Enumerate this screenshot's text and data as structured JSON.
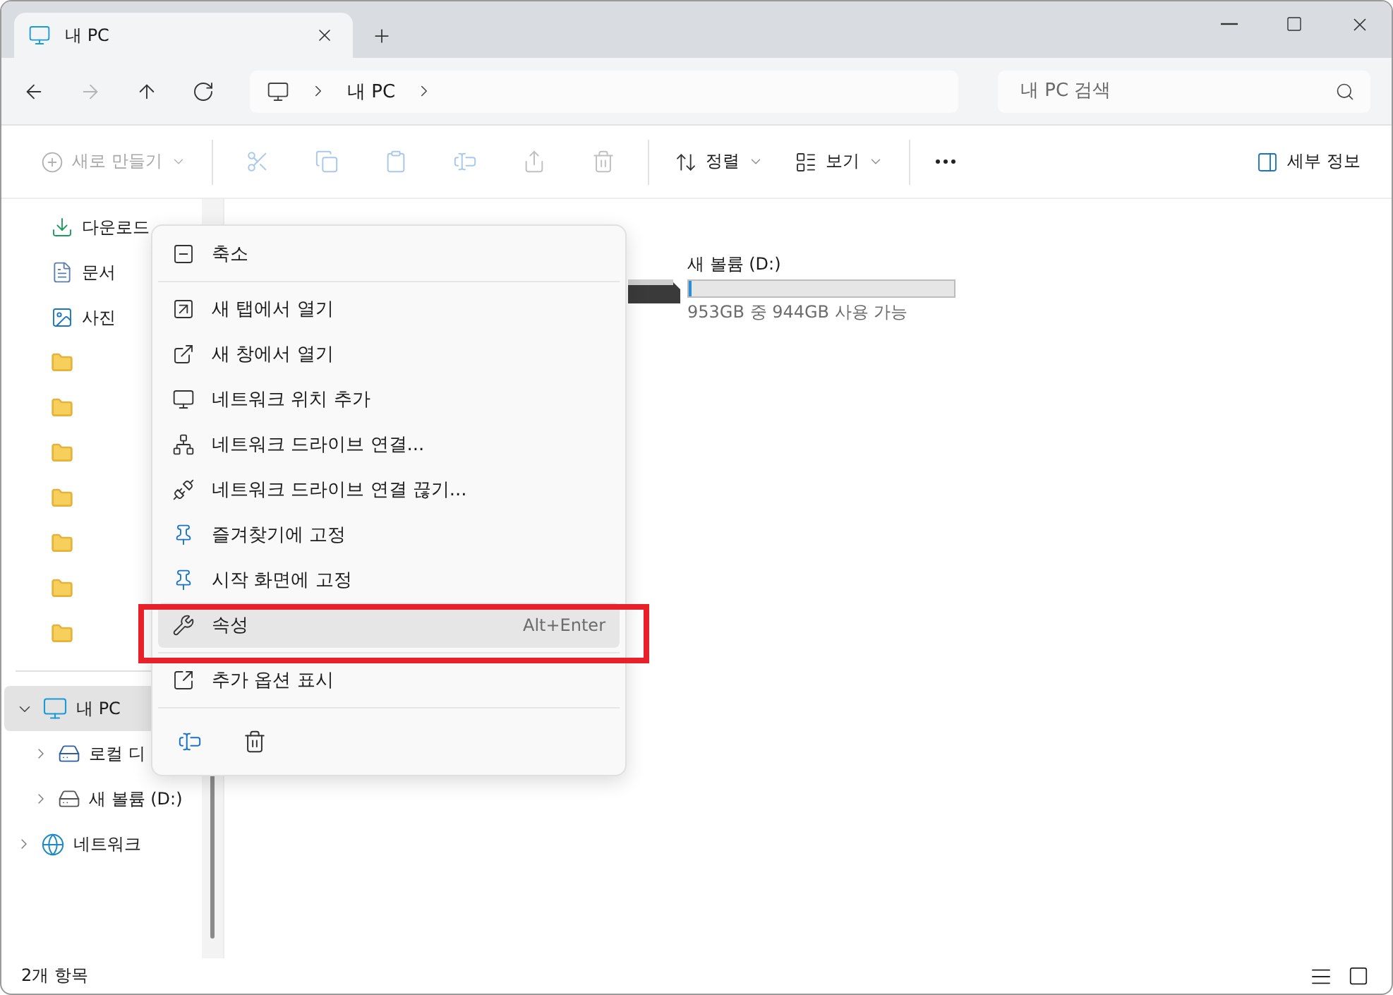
{
  "tab": {
    "title": "내 PC"
  },
  "address": {
    "crumbs": [
      "내 PC"
    ]
  },
  "search": {
    "placeholder": "내 PC 검색"
  },
  "toolbar": {
    "new_label": "새로 만들기",
    "new_disabled": true,
    "actions_disabled": true,
    "sort_label": "정렬",
    "view_label": "보기",
    "details_label": "세부 정보"
  },
  "sidebar": {
    "quick_access": [
      {
        "label": "다운로드",
        "kind": "download"
      },
      {
        "label": "문서",
        "kind": "document"
      },
      {
        "label": "사진",
        "kind": "picture"
      },
      {
        "kind": "folder"
      },
      {
        "kind": "folder"
      },
      {
        "kind": "folder"
      },
      {
        "kind": "folder"
      },
      {
        "kind": "folder"
      },
      {
        "kind": "folder"
      },
      {
        "kind": "folder"
      }
    ],
    "this_pc": {
      "label": "내 PC",
      "selected": true,
      "expanded": true,
      "children": [
        {
          "label": "로컬 디",
          "kind": "system-drive",
          "expanded": false
        },
        {
          "label": "새 볼륨 (D:)",
          "kind": "drive",
          "expanded": false
        }
      ]
    },
    "network": {
      "label": "네트워크",
      "expanded": false
    }
  },
  "drive": {
    "name": "새 볼륨 (D:)",
    "level": 0.01,
    "reading": "953GB 중 944GB 사용 가능"
  },
  "context_menu": {
    "top_item": {
      "label": "축소",
      "highlighted": false
    },
    "items": [
      {
        "label": "새 탭에서 열기",
        "highlighted": false
      },
      {
        "label": "새 창에서 열기",
        "highlighted": false
      },
      {
        "label": "네트워크 위치 추가",
        "highlighted": false
      },
      {
        "label": "네트워크 드라이브 연결...",
        "highlighted": false
      },
      {
        "label": "네트워크 드라이브 연결 끊기...",
        "highlighted": false
      },
      {
        "label": "즐겨찾기에 고정",
        "highlighted": false
      },
      {
        "label": "시작 화면에 고정",
        "highlighted": false
      },
      {
        "label": "속성",
        "shortcut": "Alt+Enter",
        "highlighted": true
      }
    ],
    "bottom_item": {
      "label": "추가 옵션 표시",
      "highlighted": false
    }
  },
  "status_bar": {
    "count": "2개 항목"
  }
}
